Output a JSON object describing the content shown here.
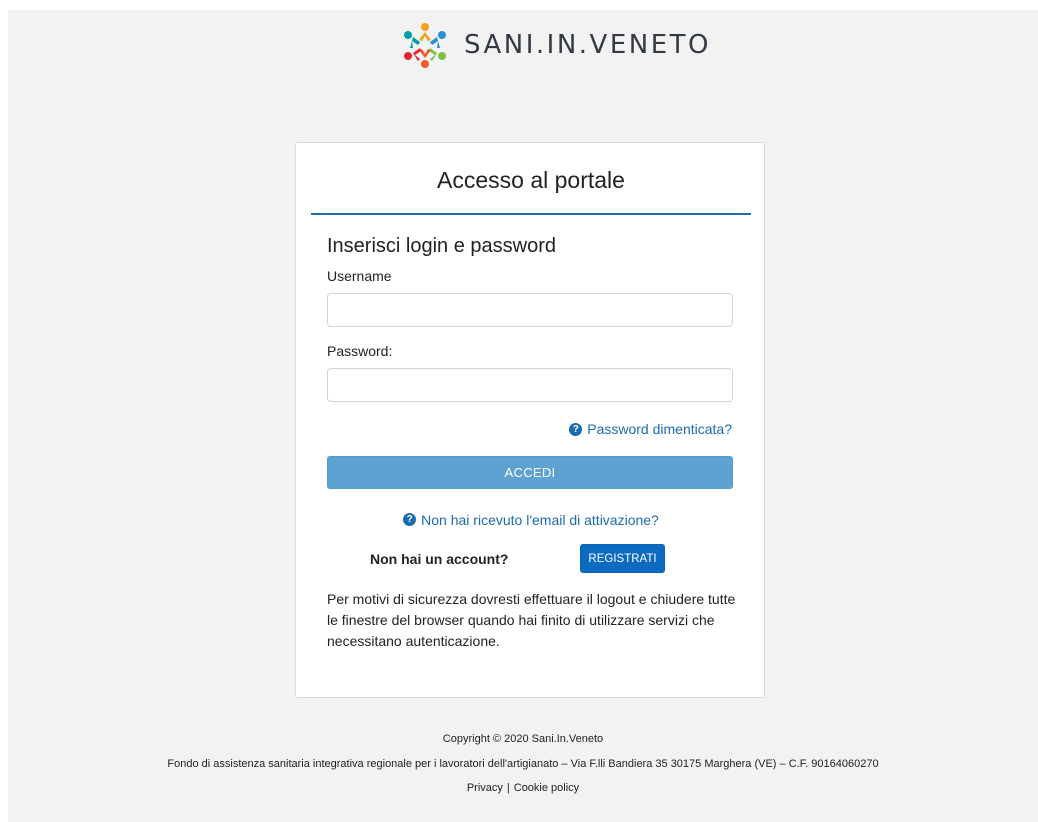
{
  "brand": {
    "name": "SANI.IN.VENETO",
    "logo_icon": "people-circle-logo"
  },
  "login": {
    "title": "Accesso al portale",
    "subtitle": "Inserisci login e password",
    "username_label": "Username",
    "username_value": "",
    "username_placeholder": "",
    "password_label": "Password:",
    "password_value": "",
    "password_placeholder": "",
    "forgot_password": "Password dimenticata?",
    "submit_label": "ACCEDI",
    "activation_link": "Non hai ricevuto l'email di attivazione?",
    "no_account_text": "Non hai un account?",
    "register_label": "REGISTRATI",
    "security_notice": "Per motivi di sicurezza dovresti effettuare il logout e chiudere tutte le finestre del browser quando hai finito di utilizzare servizi che necessitano autenticazione.",
    "help_icon": "question-circle-icon",
    "help_glyph": "?"
  },
  "footer": {
    "copyright": "Copyright © 2020 Sani.In.Veneto",
    "info": "Fondo di assistenza sanitaria integrativa regionale per i lavoratori dell'artigianato – Via F.lli Bandiera 35 30175 Marghera (VE) – C.F. 90164060270",
    "privacy_link": "Privacy",
    "separator": "|",
    "cookie_link": "Cookie policy"
  },
  "colors": {
    "accent": "#1a6bb0",
    "submit_button": "#5ea2d4",
    "register_button": "#0c6bc0",
    "background": "#f2f2f2"
  }
}
